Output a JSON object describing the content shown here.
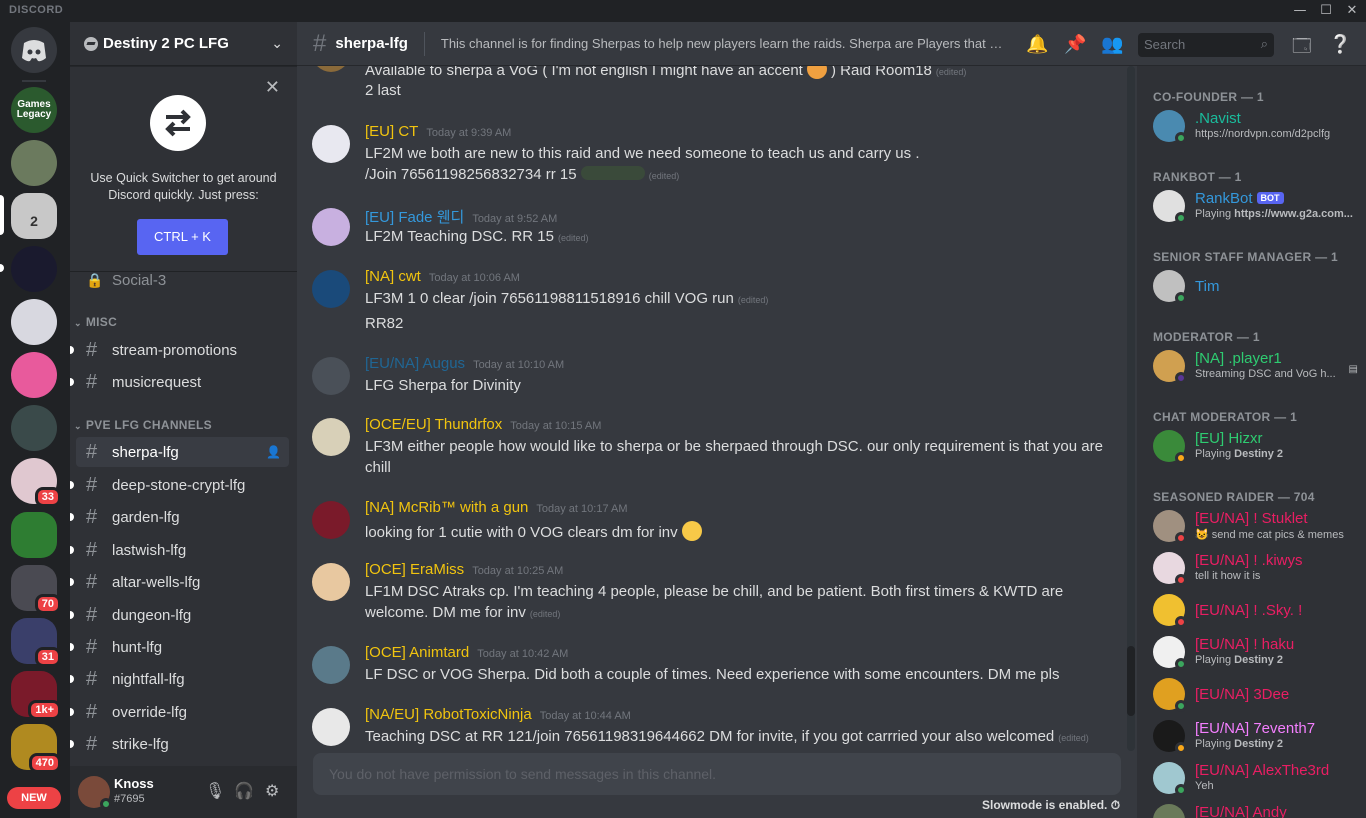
{
  "app": {
    "brand": "DISCORD"
  },
  "window": {
    "minimize": "—",
    "maximize": "☐",
    "close": "✕"
  },
  "server": {
    "name": "Destiny 2 PC LFG"
  },
  "guilds": {
    "badges": [
      "33",
      "70",
      "31",
      "1k+",
      "470"
    ],
    "new_label": "NEW",
    "legacy_label": "Games Legacy",
    "tile_number": "2"
  },
  "quick_switcher": {
    "text_line1": "Use Quick Switcher to get around",
    "text_line2": "Discord quickly. Just press:",
    "button": "CTRL + K"
  },
  "channels": {
    "locked": "Social-3",
    "categories": [
      "MISC",
      "PVE LFG CHANNELS"
    ],
    "misc": [
      "stream-promotions",
      "musicrequest"
    ],
    "pve": [
      "sherpa-lfg",
      "deep-stone-crypt-lfg",
      "garden-lfg",
      "lastwish-lfg",
      "altar-wells-lfg",
      "dungeon-lfg",
      "hunt-lfg",
      "nightfall-lfg",
      "override-lfg",
      "strike-lfg"
    ]
  },
  "user": {
    "name": "Knoss",
    "tag": "#7695"
  },
  "header": {
    "channel": "sherpa-lfg",
    "topic": "This channel is for finding Sherpas to help new players learn the raids. Sherpa are Players that are a...",
    "search_placeholder": "Search"
  },
  "messages": [
    {
      "lines": [
        "Available to sherpa a VoG ( I'm not english I might have an accent",
        ") Raid Room18",
        "2 last"
      ]
    },
    {
      "author": "[EU] CT",
      "time": "Today at 9:39 AM",
      "color": "#f1c40f",
      "lines": [
        "LF2M we both are new to this raid and we need someone to teach us and carry us .",
        "/Join 76561198256832734 rr 15"
      ]
    },
    {
      "author": "[EU] Fade 웬디",
      "time": "Today at 9:52 AM",
      "color": "#3498db",
      "lines": [
        "LF2M Teaching DSC. RR 15"
      ]
    },
    {
      "author": "[NA] cwt",
      "time": "Today at 10:06 AM",
      "color": "#f1c40f",
      "lines": [
        "LF3M 1 0 clear /join 76561198811518916 chill VOG run",
        "RR82"
      ]
    },
    {
      "author": "[EU/NA] Augus",
      "time": "Today at 10:10 AM",
      "color": "#206694",
      "lines": [
        "LFG Sherpa for Divinity"
      ]
    },
    {
      "author": "[OCE/EU] Thundrfox",
      "time": "Today at 10:15 AM",
      "color": "#f1c40f",
      "lines": [
        "LF3M either people how would like to sherpa or be sherpaed through DSC. our only requirement is that you are",
        "chill"
      ]
    },
    {
      "author": "[NA] McRib™ with a gun",
      "time": "Today at 10:17 AM",
      "color": "#f1c40f",
      "lines": [
        "looking for 1 cutie with 0 VOG clears dm for inv"
      ]
    },
    {
      "author": "[OCE] EraMiss",
      "time": "Today at 10:25 AM",
      "color": "#f1c40f",
      "lines": [
        "LF1M DSC Atraks cp. I'm teaching 4 people, please be chill, and be patient. Both first timers & KWTD are",
        "welcome. DM me for inv"
      ]
    },
    {
      "author": "[OCE] Animtard",
      "time": "Today at 10:42 AM",
      "color": "#f1c40f",
      "lines": [
        "LF DSC or VOG Sherpa. Did both a couple of times. Need experience with some encounters. DM me pls"
      ]
    },
    {
      "author": "[NA/EU] RobotToxicNinja",
      "time": "Today at 10:44 AM",
      "color": "#f1c40f",
      "lines": [
        "Teaching DSC at RR 121/join 76561198319644662 DM for invite, if you got carrried your also welcomed"
      ]
    }
  ],
  "edited_label": "(edited)",
  "composer": {
    "placeholder": "You do not have permission to send messages in this channel."
  },
  "slowmode": "Slowmode is enabled.",
  "members": {
    "roles": [
      "CO-FOUNDER — 1",
      "RANKBOT — 1",
      "SENIOR STAFF MANAGER — 1",
      "MODERATOR — 1",
      "CHAT MODERATOR — 1",
      "SEASONED RAIDER — 704"
    ],
    "list": [
      {
        "name": ".Navist",
        "status": "https://nordvpn.com/d2pclfg",
        "color": "#1abc9c"
      },
      {
        "name": "RankBot",
        "bot": "BOT",
        "status_prefix": "Playing ",
        "status": "https://www.g2a.com...",
        "color": "#3498db"
      },
      {
        "name": "Tim",
        "color": "#3498db"
      },
      {
        "name": "[NA] .player1",
        "status": "Streaming DSC and VoG h...",
        "color": "#2ecc71"
      },
      {
        "name": "[EU] Hizxr",
        "status_prefix": "Playing ",
        "status": "Destiny 2",
        "color": "#2ecc71"
      },
      {
        "name": "[EU/NA] ! Stuklet",
        "status": "send me cat pics & memes",
        "color": "#e91e63"
      },
      {
        "name": "[EU/NA] ! .kiwys",
        "status": "tell it how it is",
        "color": "#e91e63"
      },
      {
        "name": "[EU/NA] ! .Sky. !",
        "color": "#e91e63"
      },
      {
        "name": "[EU/NA] ! haku",
        "status_prefix": "Playing ",
        "status": "Destiny 2",
        "color": "#e91e63"
      },
      {
        "name": "[EU/NA] 3Dee",
        "color": "#e91e63"
      },
      {
        "name": "[EU/NA] 7eventh7",
        "status_prefix": "Playing ",
        "status": "Destiny 2",
        "color": "#f47fff"
      },
      {
        "name": "[EU/NA] AlexThe3rd",
        "status": "Yeh",
        "color": "#e91e63"
      },
      {
        "name": "[EU/NA] Andy",
        "color": "#e91e63"
      }
    ]
  }
}
